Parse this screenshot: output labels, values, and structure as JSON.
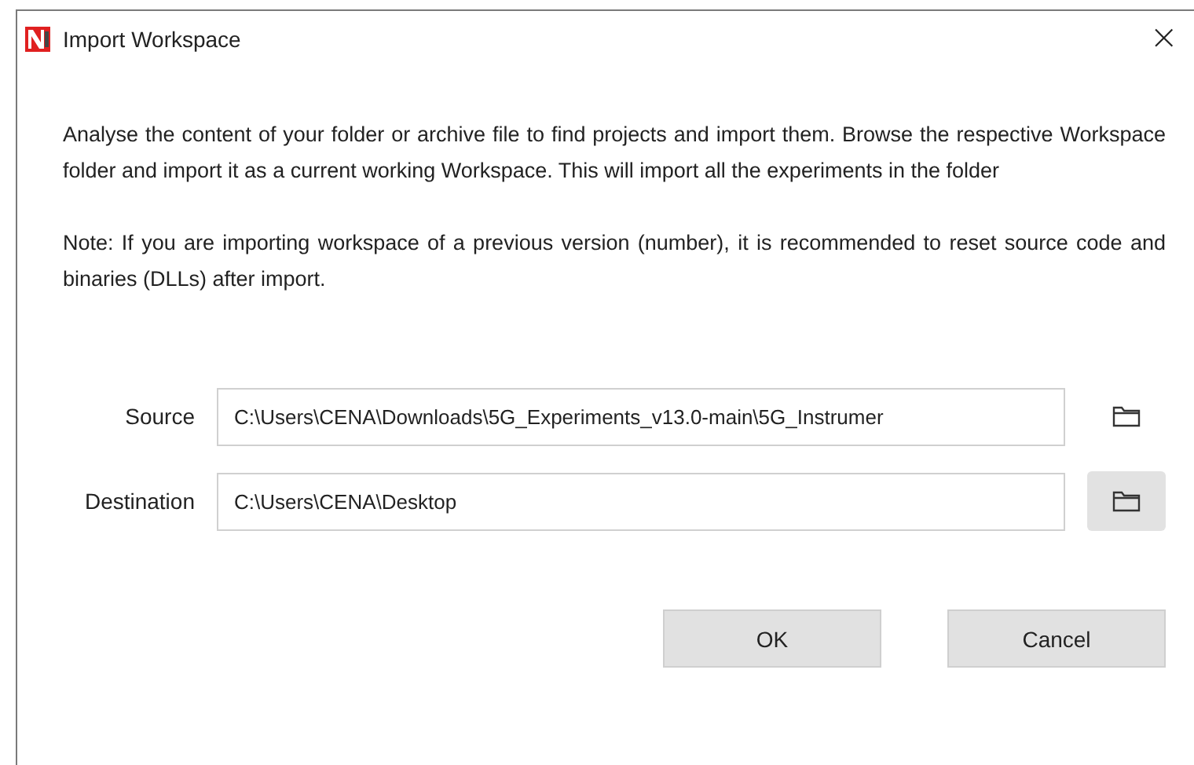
{
  "window": {
    "title": "Import Workspace",
    "close": "×"
  },
  "paragraphs": [
    "Analyse the content of your folder or archive file to find projects and import them. Browse the respective Workspace folder and import it as a current working Workspace. This will import all the experiments in the folder",
    "Note: If you are importing workspace of a previous version (number), it is recommended to reset source code and binaries (DLLs) after import."
  ],
  "fields": [
    {
      "label": "Source",
      "value": "C:\\Users\\CENA\\Downloads\\5G_Experiments_v13.0-main\\5G_Instrumer",
      "browse_hovered": false
    },
    {
      "label": "Destination",
      "value": "C:\\Users\\CENA\\Desktop",
      "browse_hovered": true
    }
  ],
  "buttons": [
    "OK",
    "Cancel"
  ]
}
